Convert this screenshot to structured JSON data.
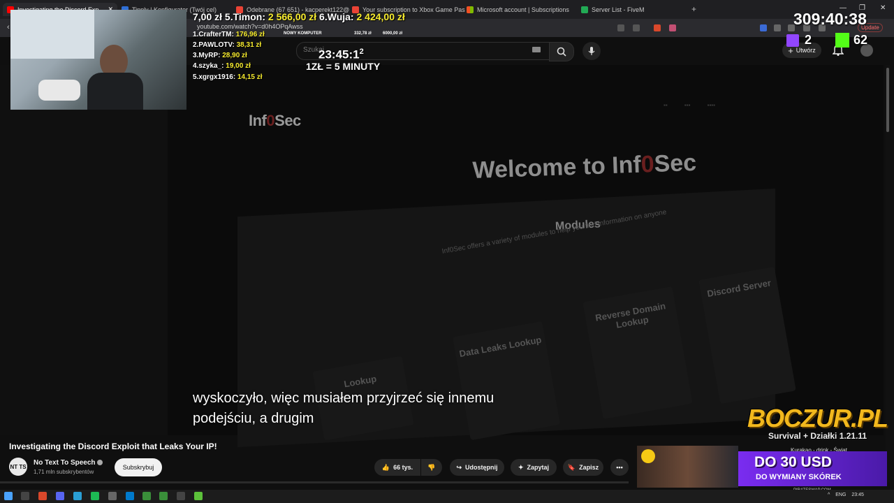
{
  "browser": {
    "tabs": [
      {
        "label": "Investigating the Discord Exp",
        "color": "#ff0000",
        "active": true
      },
      {
        "label": "Tipply | Konfigurator (Twój cel)",
        "color": "#2f6fd6"
      },
      {
        "label": "Odebrane (67 651) - kacperekt122@",
        "color": "#ea4335"
      },
      {
        "label": "Your subscription to Xbox Game Pass",
        "color": "#ea4335"
      },
      {
        "label": "Microsoft account | Subscriptions",
        "color": "#f25022"
      },
      {
        "label": "Server List - FiveM",
        "color": "#22aa55"
      }
    ],
    "url": "youtube.com/watch?v=d0h4OPqAwss",
    "update_label": "Update"
  },
  "youtube": {
    "search_placeholder": "Szukaj",
    "create_label": "Utwórz"
  },
  "video": {
    "logo_prefix": "Inf",
    "logo_zero": "0",
    "logo_suffix": "Sec",
    "welcome_prefix": "Welcome to Inf",
    "welcome_zero": "0",
    "welcome_suffix": "Sec",
    "modules_title": "Modules",
    "modules_subtitle": "Inf0Sec offers a variety of modules to help you find information on anyone",
    "cards": [
      "Data Leaks Lookup",
      "Reverse Domain Lookup",
      "Discord Server"
    ],
    "partial_card": "Lookup",
    "subtitle_line1": "wyskoczyło, więc musiałem przyjrzeć się innemu",
    "subtitle_line2": "podejściu, a drugim"
  },
  "meta": {
    "title": "Investigating the Discord Exploit that Leaks Your IP!",
    "channel_initials": "NT TS",
    "channel_name": "No Text To Speech",
    "subscribers": "1,71 mln subskrybentów",
    "subscribe_label": "Subskrybuj",
    "likes": "66 tys.",
    "share_label": "Udostępnij",
    "ask_label": "Zapytaj",
    "save_label": "Zapisz"
  },
  "overlay": {
    "donations_top": [
      {
        "prefix": "7,00 zł 5.Timon: ",
        "amount": "2 566,00 zł"
      },
      {
        "prefix": " 6.Wuja: ",
        "amount": "2 424,00 zł"
      }
    ],
    "leaderboard": [
      {
        "name": "1.CrafterTM:",
        "amount": "176,96 zł"
      },
      {
        "name": "2.PAWLOTV:",
        "amount": "38,31 zł"
      },
      {
        "name": "3.MyRP:",
        "amount": "28,90 zł"
      },
      {
        "name": "4.szyka_:",
        "amount": "19,00 zł"
      },
      {
        "name": "5.xgrgx1916:",
        "amount": "14,15 zł"
      }
    ],
    "goal_label": "NOWY KOMPUTER",
    "goal_progress": "332,78 zł",
    "goal_target": "6000,00 zł",
    "timer_small": "23:45:1",
    "timer_small_sup": "2",
    "rate": "1ZŁ = 5 MINUTY",
    "timer_big": "309:40:38",
    "twitch_viewers": "2",
    "kick_viewers": "62"
  },
  "ads": {
    "brand": "BOCZUR.PL",
    "tagline": "Survival + Działki 1.21.11",
    "kurakao": "Kurakao - drink - Świat",
    "headline": "DO 30 USD",
    "subline": "DO WYMIANY SKÓREK",
    "site": "PIRATESWAP.COM"
  },
  "taskbar": {
    "tray": "^ ENG 23:45"
  },
  "colors": {
    "youtube_red": "#ff0000",
    "donation_yellow": "#f7ec2e",
    "twitch": "#9146ff",
    "kick": "#53fc18",
    "boczur_gold": "#f2b81d"
  }
}
